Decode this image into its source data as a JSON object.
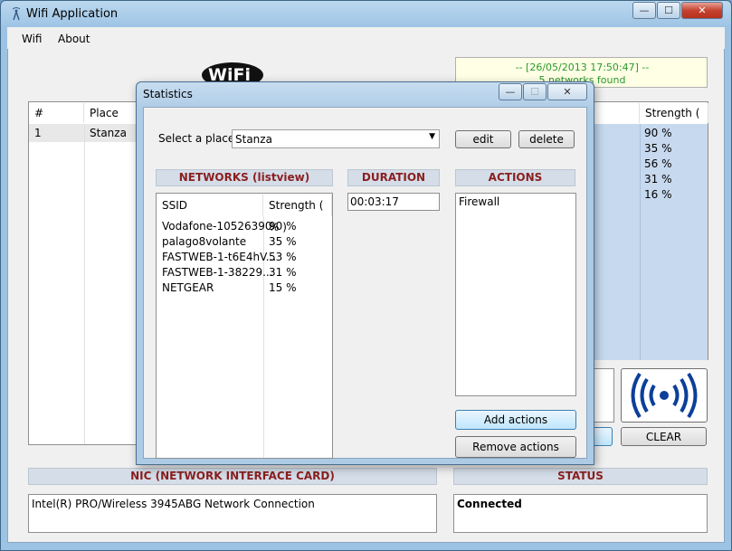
{
  "main": {
    "title": "Wifi Application",
    "controls": {
      "minimize": "—",
      "maximize": "☐",
      "close": "✕"
    },
    "menu": [
      "Wifi",
      "About"
    ],
    "logo_text": "WiFi",
    "timestamp": "-- [26/05/2013 17:50:47] --",
    "networks_found": "5 networks found",
    "table": {
      "headers": [
        "#",
        "Place"
      ],
      "rows": [
        {
          "num": "1",
          "place": "Stanza"
        }
      ]
    },
    "strength_header": "Strength ( % )",
    "strength_values": [
      "90 %",
      "35 %",
      "56 %",
      "31 %",
      "16 %"
    ],
    "clear_label": "CLEAR",
    "nic_title": "NIC (NETWORK INTERFACE CARD)",
    "nic_value": "Intel(R) PRO/Wireless 3945ABG Network Connection",
    "status_title": "STATUS",
    "status_value": "Connected"
  },
  "dialog": {
    "title": "Statistics",
    "place_label": "Select a place:",
    "place_value": "Stanza",
    "edit_label": "edit",
    "delete_label": "delete",
    "networks_title": "NETWORKS (listview)",
    "duration_title": "DURATION",
    "actions_title": "ACTIONS",
    "list_headers": [
      "SSID",
      "Strength ( % )"
    ],
    "networks": [
      {
        "ssid": "Vodafone-10526390",
        "strength": "90 %"
      },
      {
        "ssid": "palago8volante",
        "strength": "35 %"
      },
      {
        "ssid": "FASTWEB-1-t6E4hV...",
        "strength": "53 %"
      },
      {
        "ssid": "FASTWEB-1-38229...",
        "strength": "31 %"
      },
      {
        "ssid": "NETGEAR",
        "strength": "15 %"
      }
    ],
    "duration_value": "00:03:17",
    "actions": [
      "Firewall"
    ],
    "add_actions_label": "Add actions",
    "remove_actions_label": "Remove actions"
  },
  "colors": {
    "section_title": "#8b1f1f",
    "timestamp_green": "#2a9a2a",
    "highlight_blue": "#c7d9ee"
  }
}
